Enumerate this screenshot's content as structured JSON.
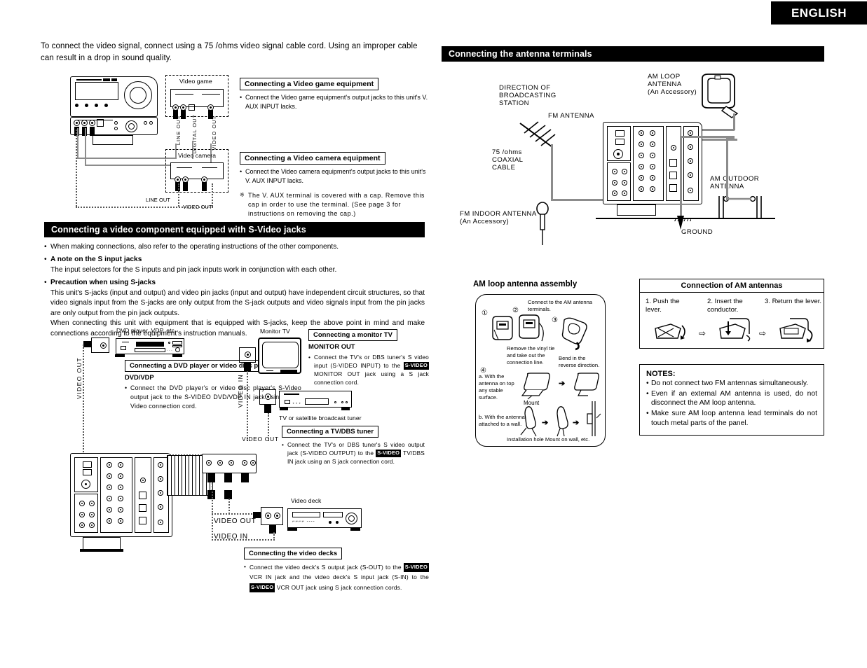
{
  "header": {
    "language": "ENGLISH"
  },
  "intro": {
    "text": "To connect the video signal, connect using a 75   /ohms video signal cable cord. Using an improper cable can result in a drop in sound quality."
  },
  "left_column": {
    "video_game": {
      "device_label": "Video game",
      "caption": "Connecting a Video game equipment",
      "bullet": "Connect the Video game equipment's output jacks to this unit's V. AUX INPUT lacks.",
      "cable_labels": [
        "LINE OUT",
        "DIGITAL OUT",
        "VIDEO OUT"
      ]
    },
    "video_camera": {
      "device_label": "Video camera",
      "caption": "Connecting a Video camera equipment",
      "bullet": "Connect the Video camera equipment's output jacks to this unit's V. AUX INPUT lacks.",
      "note_mark": "※",
      "note": "The V. AUX terminal is covered with a cap. Remove this cap in order to use the terminal.  (See page 3 for instructions on removing the cap.)",
      "cable_labels": [
        "LINE OUT",
        "VIDEO OUT"
      ]
    },
    "svideo_section": {
      "title": "Connecting a video component equipped with S-Video jacks",
      "items": [
        {
          "lead": "",
          "text": "When making connections, also refer to the operating instructions of the other components."
        },
        {
          "lead": "A note on the S input jacks",
          "text": "The input selectors for the S inputs and pin jack inputs work in conjunction with each other."
        },
        {
          "lead": "Precaution when using S-jacks",
          "text": "This unit's S-jacks (input and output) and video pin jacks (input and output) have independent circuit structures, so that video signals input from the S-jacks are only output from the S-jack outputs and video signals input from the pin jacks are only output from the pin jack outputs.",
          "text2": "When connecting this unit with equipment that is equipped with S-jacks, keep the above point in mind and make connections according to the equipment's instruction manuals."
        }
      ]
    },
    "dvd": {
      "device_label": "DVD player, VDP, etc.",
      "caption": "Connecting a DVD player or video disc player (VDP)",
      "sub": "DVD/VDP",
      "bullet": "Connect the DVD player's or video disc player's S-Video output jack to the S-VIDEO DVD/VDP IN jack using an S-Video connection cord.",
      "cable_label": "VIDEO OUT"
    },
    "monitor": {
      "device_label": "Monitor TV",
      "caption": "Connecting a monitor TV",
      "sub": "MONITOR OUT",
      "bullet_a": "Connect the TV's or DBS tuner's S video input (S-VIDEO INPUT) to the",
      "bullet_inv": "S-VIDEO",
      "bullet_b": "MONITOR OUT jack using a S jack connection cord.",
      "cable_label": "VIDEO IN"
    },
    "tv_dbs": {
      "device_label": "TV or satellite broadcast tuner",
      "caption": "Connecting a TV/DBS tuner",
      "bullet_a": "Connect the TV's or DBS tuner's S video output jack (S-VIDEO OUTPUT) to the",
      "bullet_inv": "S-VIDEO",
      "bullet_b": "TV/DBS IN jack using an S jack connection cord.",
      "cable_label": "VIDEO OUT"
    },
    "video_deck": {
      "device_label": "Video deck",
      "caption": "Connecting the video decks",
      "bullet_a": "Connect the video deck's S output jack (S-OUT) to the",
      "bullet_inv1": "S-VIDEO",
      "bullet_b": "VCR IN jack and the video deck's S input jack (S-IN) to the",
      "bullet_inv2": "S-VIDEO",
      "bullet_c": "VCR OUT jack using S jack connection cords.",
      "cable_labels": [
        "VIDEO OUT",
        "VIDEO IN"
      ]
    }
  },
  "right_column": {
    "section_title": "Connecting the antenna terminals",
    "labels": {
      "direction": "DIRECTION OF\nBROADCASTING\nSTATION",
      "fm_antenna": "FM ANTENNA",
      "coaxial": "75   /ohms\nCOAXIAL\nCABLE",
      "fm_indoor": "FM INDOOR ANTENNA\n(An Accessory)",
      "am_loop": "AM LOOP\nANTENNA\n(An Accessory)",
      "am_outdoor": "AM OUTDOOR\nANTENNA",
      "ground": "GROUND"
    },
    "assembly": {
      "title": "AM loop antenna assembly",
      "step1_num": "①",
      "step2_num": "②",
      "step3_num": "③",
      "step4_num": "④",
      "connect_note": "Connect to the AM antenna terminals.",
      "step12_text": "Remove the vinyl tie and take out the connection line.",
      "step3_text": "Bend in the reverse direction.",
      "step4a": "a. With the antenna on top any stable surface.",
      "mount": "Mount",
      "step4b": "b. With the antenna attached to a wall.",
      "install_note": "Installation hole Mount on wall, etc."
    },
    "am_connection": {
      "title": "Connection of AM antennas",
      "steps": [
        "1. Push the lever.",
        "2. Insert the\n    conductor.",
        "3. Return the lever."
      ]
    },
    "notes": {
      "title": "NOTES:",
      "items": [
        "Do not connect two FM antennas simultaneously.",
        "Even if an external AM antenna is used, do not disconnect the AM loop antenna.",
        "Make sure AM loop antenna lead terminals do not touch metal parts of the panel."
      ]
    }
  }
}
